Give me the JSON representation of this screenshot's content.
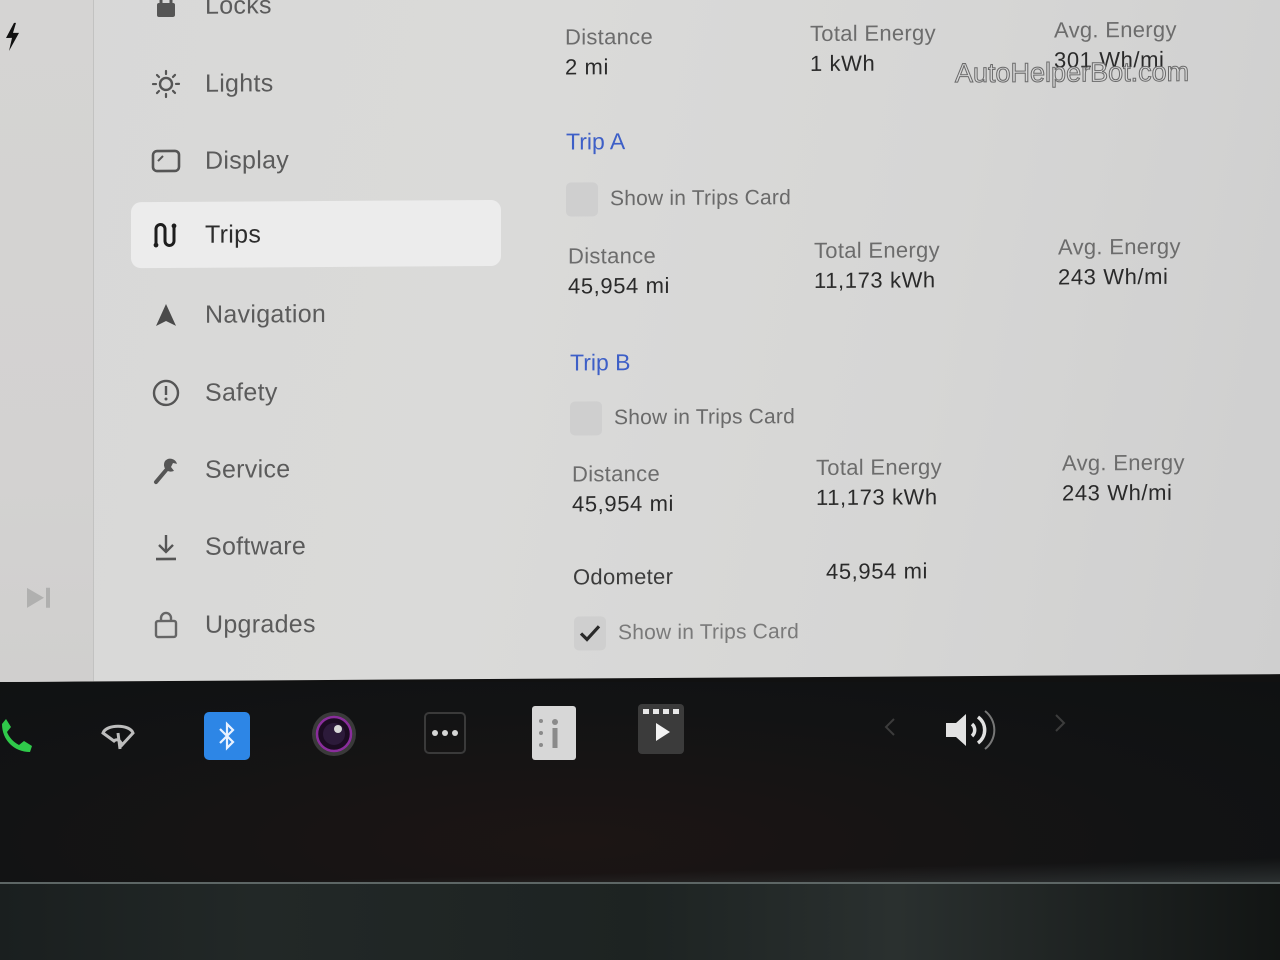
{
  "status": {
    "charging_icon": "lightning-bolt-icon"
  },
  "left_strip": {
    "media_icon": "skip-forward-icon"
  },
  "sidebar": {
    "items": [
      {
        "label": "Locks",
        "icon": "lock-icon",
        "active": false
      },
      {
        "label": "Lights",
        "icon": "light-bulb-icon",
        "active": false
      },
      {
        "label": "Display",
        "icon": "display-icon",
        "active": false
      },
      {
        "label": "Trips",
        "icon": "trips-route-icon",
        "active": true
      },
      {
        "label": "Navigation",
        "icon": "navigation-arrow-icon",
        "active": false
      },
      {
        "label": "Safety",
        "icon": "alert-circle-icon",
        "active": false
      },
      {
        "label": "Service",
        "icon": "wrench-icon",
        "active": false
      },
      {
        "label": "Software",
        "icon": "download-icon",
        "active": false
      },
      {
        "label": "Upgrades",
        "icon": "shopping-bag-icon",
        "active": false
      }
    ]
  },
  "current_trip": {
    "distance_label": "Distance",
    "distance_value": "2 mi",
    "energy_label": "Total Energy",
    "energy_value": "1 kWh",
    "avg_label": "Avg. Energy",
    "avg_value": "301 Wh/mi"
  },
  "trip_a": {
    "title": "Trip A",
    "show_label": "Show in Trips Card",
    "show_checked": false,
    "distance_label": "Distance",
    "distance_value": "45,954 mi",
    "energy_label": "Total Energy",
    "energy_value": "11,173 kWh",
    "avg_label": "Avg. Energy",
    "avg_value": "243 Wh/mi"
  },
  "trip_b": {
    "title": "Trip B",
    "show_label": "Show in Trips Card",
    "show_checked": false,
    "distance_label": "Distance",
    "distance_value": "45,954 mi",
    "energy_label": "Total Energy",
    "energy_value": "11,173 kWh",
    "avg_label": "Avg. Energy",
    "avg_value": "243 Wh/mi"
  },
  "odometer": {
    "label": "Odometer",
    "value": "45,954 mi",
    "show_label": "Show in Trips Card",
    "show_checked": true
  },
  "watermark": "AutoHelperBot.com",
  "taskbar": {
    "icons": [
      "phone-icon",
      "wiper-icon",
      "bluetooth-icon",
      "camera-icon",
      "more-apps-icon",
      "info-manual-icon",
      "video-player-icon"
    ],
    "volume": {
      "icon": "volume-icon",
      "prev": "chevron-left-icon",
      "next": "chevron-right-icon"
    },
    "colors": {
      "bluetooth": "#2d86e6",
      "phone": "#2fc94a",
      "camera_ring": "#8a2d9c"
    }
  },
  "colors": {
    "accent": "#3d5fc7",
    "active_item_bg": "#ececec",
    "screen_bg": "#d8d8d7"
  }
}
